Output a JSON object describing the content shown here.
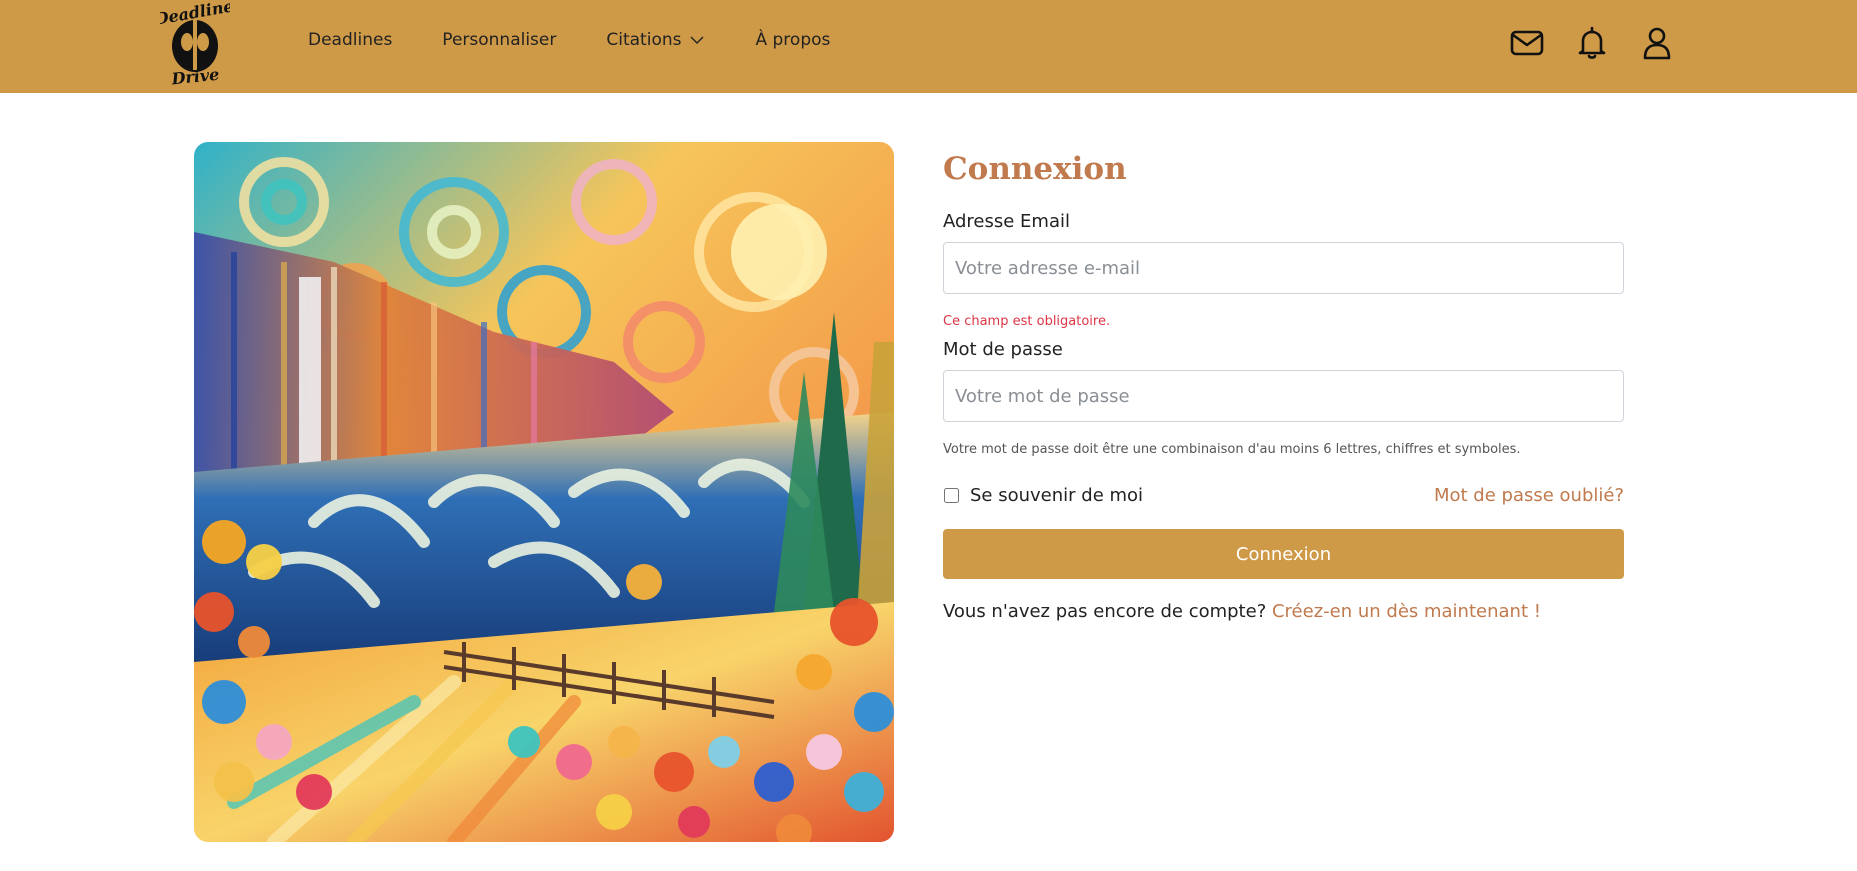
{
  "brand": {
    "logo_icon": "deadline-drive-logo",
    "logo_text_line1": "Deadline",
    "logo_text_line2": "Drive"
  },
  "nav": {
    "items": [
      {
        "label": "Deadlines"
      },
      {
        "label": "Personnaliser"
      },
      {
        "label": "Citations",
        "icon": "chevron-down-icon"
      },
      {
        "label": "À propos"
      }
    ],
    "icons": [
      "mail-icon",
      "bell-icon",
      "user-icon"
    ]
  },
  "hero": {
    "image": "colorful-impressionist-landscape"
  },
  "login": {
    "title": "Connexion",
    "email_label": "Adresse Email",
    "email_placeholder": "Votre adresse e-mail",
    "email_value": "",
    "email_error": "Ce champ est obligatoire.",
    "password_label": "Mot de passe",
    "password_placeholder": "Votre mot de passe",
    "password_value": "",
    "password_hint": "Votre mot de passe doit être une combinaison d'au moins 6 lettres, chiffres et symboles.",
    "remember_label": "Se souvenir de moi",
    "remember_checked": false,
    "forgot_label": "Mot de passe oublié?",
    "submit_label": "Connexion",
    "signup_text": "Vous n'avez pas encore de compte?",
    "signup_link": "Créez-en un dès maintenant !"
  },
  "colors": {
    "header_bg": "#cf9a47",
    "accent_text": "#c07a4e",
    "error": "#dc3545",
    "button_bg": "#cf9a47"
  }
}
